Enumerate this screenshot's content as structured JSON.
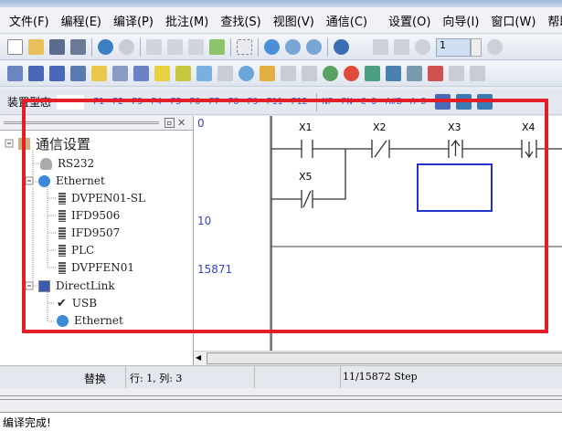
{
  "menu": [
    "文件(F)",
    "编程(E)",
    "编译(P)",
    "批注(M)",
    "查找(S)",
    "视图(V)",
    "通信(C)",
    "设置(O)",
    "向导(I)",
    "窗口(W)",
    "帮助"
  ],
  "toolbar1": {
    "step_value": "1"
  },
  "devbar": {
    "label": "装置型态",
    "fkeys": [
      "F1",
      "F2",
      "F3",
      "F4",
      "F5",
      "F6",
      "F7",
      "F8",
      "F9",
      "F11",
      "F12",
      "NP",
      "PN",
      "C-D",
      "A#B",
      "A-D"
    ]
  },
  "tree": {
    "root": "通信设置",
    "rs232": "RS232",
    "ethernet": "Ethernet",
    "eth_children": [
      "DVPEN01-SL",
      "IFD9506",
      "IFD9507",
      "PLC",
      "DVPFEN01"
    ],
    "directlink": "DirectLink",
    "usb": "USB",
    "dl_ethernet": "Ethernet"
  },
  "rows": [
    "0",
    "10",
    "15871"
  ],
  "ladder": {
    "contacts": [
      "X1",
      "X2",
      "X3",
      "X4",
      "X5"
    ]
  },
  "status": {
    "mode": "替换",
    "position": "行: 1, 列: 3",
    "steps": "11/15872 Step"
  },
  "output": {
    "message": "编译完成!"
  },
  "colors": {
    "highlight": "#e41e26",
    "cursor": "#2233cc",
    "row_number": "#3344cc"
  }
}
